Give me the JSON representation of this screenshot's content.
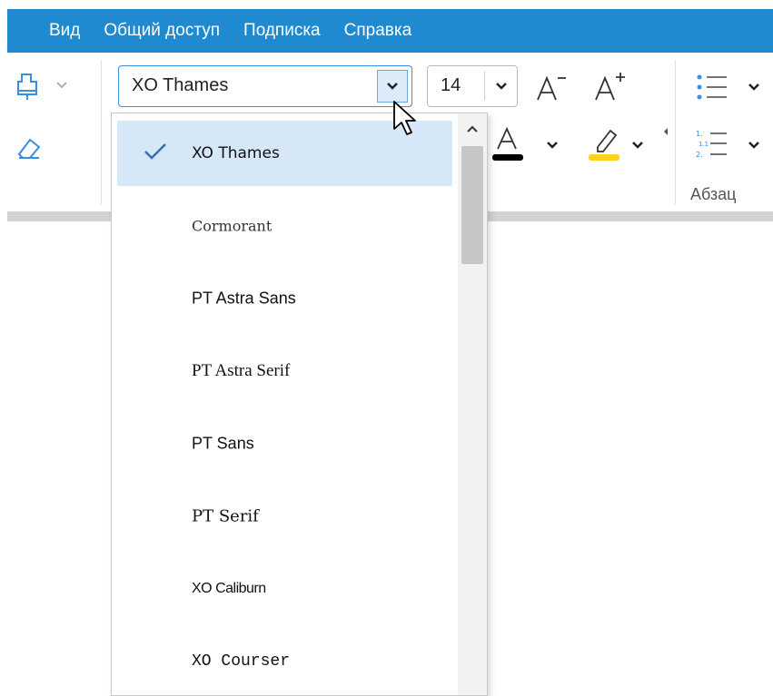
{
  "menubar": {
    "items": [
      "Вид",
      "Общий доступ",
      "Подписка",
      "Справка"
    ],
    "background": "#1f8ad0"
  },
  "ribbon": {
    "font_name": "XO Thames",
    "font_size": "14",
    "paragraph_group_label": "Абзац",
    "icons": [
      "format-painter-icon",
      "eraser-icon",
      "decrease-font-size-icon",
      "increase-font-size-icon",
      "font-color-icon",
      "highlight-color-icon",
      "bullet-list-icon",
      "numbered-list-icon"
    ],
    "font_color": "#000000",
    "highlight_color": "#ffd21e"
  },
  "font_dropdown": {
    "selected": "XO Thames",
    "items": [
      "XO Thames",
      "Cormorant",
      "PT Astra Sans",
      "PT Astra Serif",
      "PT Sans",
      "PT Serif",
      "XO Caliburn",
      "XO Courser"
    ]
  },
  "colors": {
    "accent": "#1f8ad0",
    "selected_item": "#d6e8f8"
  }
}
